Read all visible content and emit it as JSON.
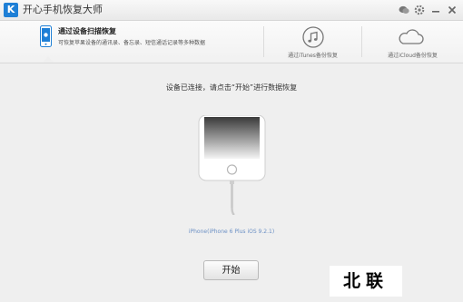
{
  "window": {
    "logo_letter": "K",
    "title": "开心手机恢复大师"
  },
  "tabs": [
    {
      "title": "通过设备扫描恢复",
      "description": "可恢复苹果设备的通讯录、备忘录、短信通话记录等多种数据",
      "icon": "phone-apple-icon",
      "active": true
    },
    {
      "label": "通过iTunes备份恢复",
      "icon": "music-note-icon"
    },
    {
      "label": "通过iCloud备份恢复",
      "icon": "cloud-icon"
    }
  ],
  "main": {
    "prompt": "设备已连接，请点击“开始”进行数据恢复",
    "device_info": "iPhone(iPhone 6 Plus iOS 9.2.1)",
    "start_label": "开始"
  },
  "watermark": "北联",
  "colors": {
    "accent": "#1e7fd6",
    "device_info": "#6a8fc4",
    "background": "#efefef"
  }
}
